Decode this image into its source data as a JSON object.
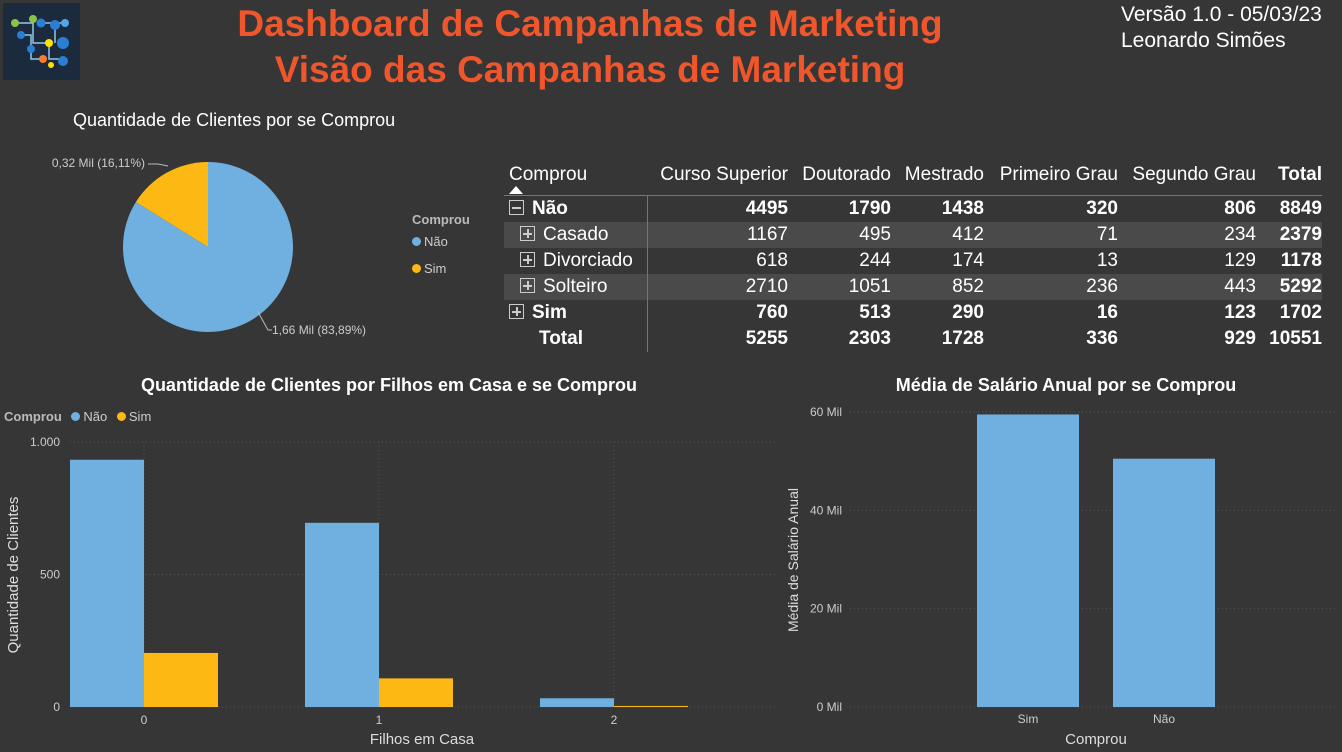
{
  "header": {
    "title_line1": "Dashboard de Campanhas de Marketing",
    "title_line2": "Visão das Campanhas de Marketing",
    "version": "Versão 1.0 - 05/03/23",
    "author": "Leonardo Simões",
    "logo_icon": "circuit-logo-icon"
  },
  "colors": {
    "nao": "#6fb0e0",
    "sim": "#fdb813",
    "title": "#f0562c",
    "background": "#363636"
  },
  "pie": {
    "title": "Quantidade de Clientes por se Comprou",
    "legend_title": "Comprou",
    "legend": [
      "Não",
      "Sim"
    ],
    "labels": [
      "1,66 Mil (83,89%)",
      "0,32 Mil (16,11%)"
    ]
  },
  "matrix": {
    "columns": [
      "Comprou",
      "Curso Superior",
      "Doutorado",
      "Mestrado",
      "Primeiro Grau",
      "Segundo Grau",
      "Total"
    ],
    "rows": [
      {
        "label": "Não",
        "level": 0,
        "expander": "minus",
        "values": [
          "4495",
          "1790",
          "1438",
          "320",
          "806",
          "8849"
        ]
      },
      {
        "label": "Casado",
        "level": 1,
        "expander": "plus",
        "values": [
          "1167",
          "495",
          "412",
          "71",
          "234",
          "2379"
        ]
      },
      {
        "label": "Divorciado",
        "level": 1,
        "expander": "plus",
        "values": [
          "618",
          "244",
          "174",
          "13",
          "129",
          "1178"
        ]
      },
      {
        "label": "Solteiro",
        "level": 1,
        "expander": "plus",
        "values": [
          "2710",
          "1051",
          "852",
          "236",
          "443",
          "5292"
        ]
      },
      {
        "label": "Sim",
        "level": 0,
        "expander": "plus",
        "values": [
          "760",
          "513",
          "290",
          "16",
          "123",
          "1702"
        ]
      },
      {
        "label": "Total",
        "level": 0,
        "expander": "none",
        "values": [
          "5255",
          "2303",
          "1728",
          "336",
          "929",
          "10551"
        ]
      }
    ]
  },
  "chart_data": [
    {
      "type": "pie",
      "title": "Quantidade de Clientes por se Comprou",
      "categories": [
        "Não",
        "Sim"
      ],
      "values": [
        1.66,
        0.32
      ],
      "percentages": [
        83.89,
        16.11
      ],
      "unit": "Mil",
      "legend_title": "Comprou",
      "legend_position": "right"
    },
    {
      "type": "bar",
      "title": "Quantidade de Clientes por Filhos em Casa e se Comprou",
      "categories": [
        "0",
        "1",
        "2"
      ],
      "series": [
        {
          "name": "Não",
          "values": [
            933,
            695,
            33
          ]
        },
        {
          "name": "Sim",
          "values": [
            204,
            108,
            4
          ]
        }
      ],
      "xlabel": "Filhos em Casa",
      "ylabel": "Quantidade de Clientes",
      "legend_title": "Comprou",
      "legend_position": "top-left",
      "yticks": [
        "0",
        "500",
        "1.000"
      ],
      "ylim": [
        0,
        1000
      ],
      "grid": true
    },
    {
      "type": "bar",
      "title": "Média de Salário Anual por se Comprou",
      "categories": [
        "Sim",
        "Não"
      ],
      "values": [
        59500,
        50500
      ],
      "xlabel": "Comprou",
      "ylabel": "Média de Salário Anual",
      "yticks": [
        "0 Mil",
        "20 Mil",
        "40 Mil",
        "60 Mil"
      ],
      "ylim": [
        0,
        60000
      ],
      "grid": true
    }
  ]
}
